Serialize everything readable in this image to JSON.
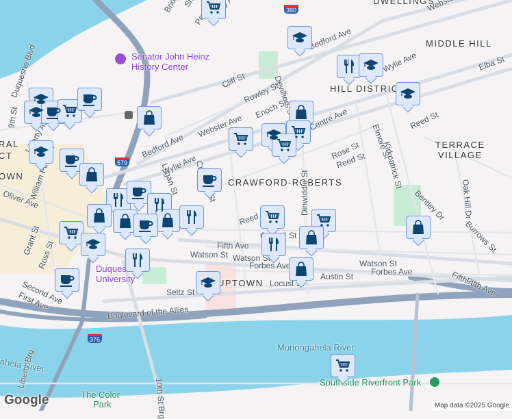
{
  "map": {
    "colors": {
      "water": "#8ad3ea",
      "land": "#f5f3f3",
      "highway": "#8fa3bd",
      "road": "#ffffff",
      "park": "#c8ecd5",
      "marker_bg": "#dde8fb",
      "marker_icon": "#0d4470"
    },
    "labels": {
      "neighborhoods": [
        "DWELLINGS",
        "MIDDLE HILL",
        "HILL DISTRICT",
        "TERRACE",
        "VILLAGE",
        "CRAWFORD-ROBERTS",
        "UPTOWN",
        "RAL",
        "CT",
        "OWN"
      ],
      "streets": [
        "Webster Ave",
        "Bedford Ave",
        "Wylie Ave",
        "Elba St",
        "Liberty Ave",
        "Bridge",
        "Smallman St",
        "Penn Ave",
        "Cliff St",
        "Rowley St",
        "Enoch St",
        "Devilliers St",
        "Webster Ave",
        "Centre Ave",
        "Reed St",
        "Elmore St",
        "Kirkpatrick St",
        "Rose St",
        "Reed St",
        "Oak Hill Dr",
        "Bentley Dr",
        "Burrows St",
        "Bedford Ave",
        "Logan St",
        "Wylie Ave",
        "Crawford St",
        "Oliver Ave",
        "William Penn Pl",
        "9th St",
        "Duquesne Blvd",
        "Liberty Ave",
        "Grant St",
        "Ross St",
        "Second Ave",
        "First Ave",
        "Fifth Ave",
        "Watson St",
        "Forbes Ave",
        "Locust St",
        "Seltz St",
        "Reed St",
        "Colwell St",
        "Dinwiddie St",
        "Watson St",
        "Forbes Ave",
        "Fifth Ave",
        "Austin St",
        "Boulevard of the Allies",
        "10th St Brg",
        "Liberty Brg",
        "Watson St",
        "Fifth Ave"
      ],
      "water": [
        "Monongahela River",
        "ahela River"
      ],
      "parks": [
        "The Color",
        "Park",
        "Southside Riverfront Park"
      ],
      "poi": [
        "Senator John Heinz",
        "History Center",
        "Duquesne",
        "University"
      ],
      "shields": [
        "579",
        "376",
        "380"
      ]
    },
    "markers": [
      "cart",
      "graduation-cap",
      "fork-knife",
      "graduation-cap",
      "graduation-cap",
      "shopping-bag",
      "shopping-bag",
      "cart",
      "graduation-cap",
      "cart",
      "cart",
      "graduation-cap",
      "graduation-cap",
      "coffee-cup",
      "cart",
      "coffee-cup",
      "graduation-cap",
      "coffee-cup",
      "shopping-bag",
      "coffee-cup",
      "fork-knife",
      "coffee-cup",
      "fork-knife",
      "shopping-bag",
      "shopping-bag",
      "fork-knife",
      "shopping-bag",
      "coffee-cup",
      "cart",
      "graduation-cap",
      "cart",
      "cart",
      "shopping-bag",
      "fork-knife",
      "shopping-bag",
      "shopping-bag",
      "fork-knife",
      "coffee-cup",
      "graduation-cap",
      "cart"
    ],
    "logo": "Google",
    "attribution": "Map data ©2025 Google"
  }
}
